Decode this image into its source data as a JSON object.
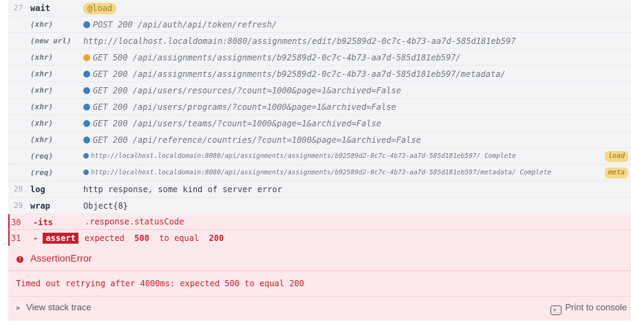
{
  "rows": [
    {
      "num": "27",
      "cmd": "wait",
      "pill": "@load"
    },
    {
      "child": "(xhr)",
      "msg": "POST 200 /api/auth/api/token/refresh/"
    },
    {
      "child": "(new url)",
      "msg": "http://localhost.localdomain:8080/assignments/edit/b92589d2-0c7c-4b73-aa7d-585d181eb597"
    },
    {
      "child": "(xhr)",
      "msg": "GET 500 /api/assignments/assignments/b92589d2-0c7c-4b73-aa7d-585d181eb597/"
    },
    {
      "child": "(xhr)",
      "msg": "GET 200 /api/assignments/assignments/b92589d2-0c7c-4b73-aa7d-585d181eb597/metadata/"
    },
    {
      "child": "(xhr)",
      "msg": "GET 200 /api/users/resources/?count=1000&page=1&archived=False"
    },
    {
      "child": "(xhr)",
      "msg": "GET 200 /api/users/programs/?count=1000&page=1&archived=False"
    },
    {
      "child": "(xhr)",
      "msg": "GET 200 /api/users/teams/?count=1000&page=1&archived=False"
    },
    {
      "child": "(xhr)",
      "msg": "GET 200 /api/reference/countries/?count=1000&page=1&archived=False"
    },
    {
      "child": "(req)",
      "msg": "http://localhost.localdomain:8080/api/assignments/assignments/b92589d2-0c7c-4b73-aa7d-585d181eb597/ Complete",
      "tag": "load"
    },
    {
      "child": "(req)",
      "msg": "http://localhost.localdomain:8080/api/assignments/assignments/b92589d2-0c7c-4b73-aa7d-585d181eb597/metadata/ Complete",
      "tag": "meta"
    },
    {
      "num": "28",
      "cmd": "log",
      "msg": "http response, some kind of server error"
    },
    {
      "num": "29",
      "cmd": "wrap",
      "msg": "Object{8}"
    },
    {
      "num": "30",
      "cmd": "-its",
      "msg": ".response.statusCode"
    },
    {
      "num": "31",
      "cmd": "-",
      "badge": "assert",
      "msg_pre": "expected",
      "val1": "500",
      "msg_mid": "to equal",
      "val2": "200"
    }
  ],
  "error": {
    "title": "AssertionError",
    "icon": "exclamation-icon",
    "message": "Timed out retrying after 4000ms: expected 500 to equal 200",
    "stack_label": "View stack trace",
    "print_label": "Print to console",
    "print_icon": "terminal-icon"
  },
  "colors": {
    "xhr_dot": "#3a7ec4",
    "error_dot": "#f0a12f",
    "error_red": "#c81e32",
    "pill": "#f7d885"
  }
}
